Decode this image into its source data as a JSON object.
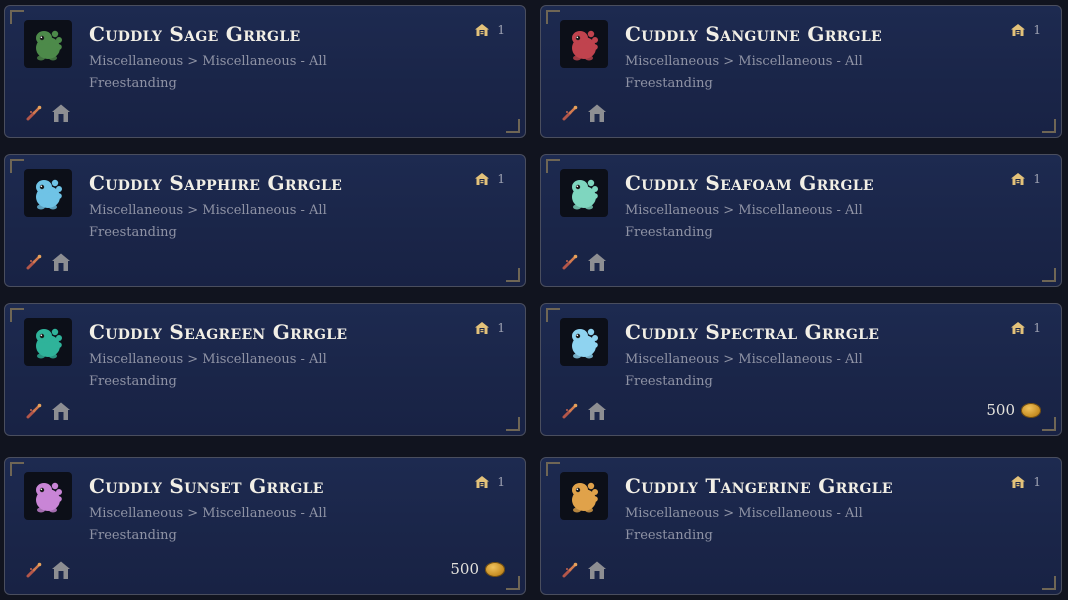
{
  "items": [
    {
      "title": "Cuddly Sage Grrgle",
      "category": "Miscellaneous > Miscellaneous - All",
      "placement": "Freestanding",
      "owned": "1",
      "price": "",
      "icon": "sage-grrgle-icon",
      "color": "#4d8a4a"
    },
    {
      "title": "Cuddly Sanguine Grrgle",
      "category": "Miscellaneous > Miscellaneous - All",
      "placement": "Freestanding",
      "owned": "1",
      "price": "",
      "icon": "sanguine-grrgle-icon",
      "color": "#c0434e"
    },
    {
      "title": "Cuddly Sapphire Grrgle",
      "category": "Miscellaneous > Miscellaneous - All",
      "placement": "Freestanding",
      "owned": "1",
      "price": "",
      "icon": "sapphire-grrgle-icon",
      "color": "#6fc3e6"
    },
    {
      "title": "Cuddly Seafoam Grrgle",
      "category": "Miscellaneous > Miscellaneous - All",
      "placement": "Freestanding",
      "owned": "1",
      "price": "",
      "icon": "seafoam-grrgle-icon",
      "color": "#7fd6bf"
    },
    {
      "title": "Cuddly Seagreen Grrgle",
      "category": "Miscellaneous > Miscellaneous - All",
      "placement": "Freestanding",
      "owned": "1",
      "price": "",
      "icon": "seagreen-grrgle-icon",
      "color": "#2fb39a"
    },
    {
      "title": "Cuddly Spectral Grrgle",
      "category": "Miscellaneous > Miscellaneous - All",
      "placement": "Freestanding",
      "owned": "1",
      "price": "500",
      "icon": "spectral-grrgle-icon",
      "color": "#8fd3f0"
    },
    {
      "title": "Cuddly Sunset Grrgle",
      "category": "Miscellaneous > Miscellaneous - All",
      "placement": "Freestanding",
      "owned": "1",
      "price": "500",
      "icon": "sunset-grrgle-icon",
      "color": "#c985d6"
    },
    {
      "title": "Cuddly Tangerine Grrgle",
      "category": "Miscellaneous > Miscellaneous - All",
      "placement": "Freestanding",
      "owned": "1",
      "price": "",
      "icon": "tangerine-grrgle-icon",
      "color": "#e0a24a"
    }
  ],
  "colors": {
    "accent_gold": "#e3c27a",
    "text_muted": "#8f93a5",
    "card_bg": "#1b2649"
  }
}
